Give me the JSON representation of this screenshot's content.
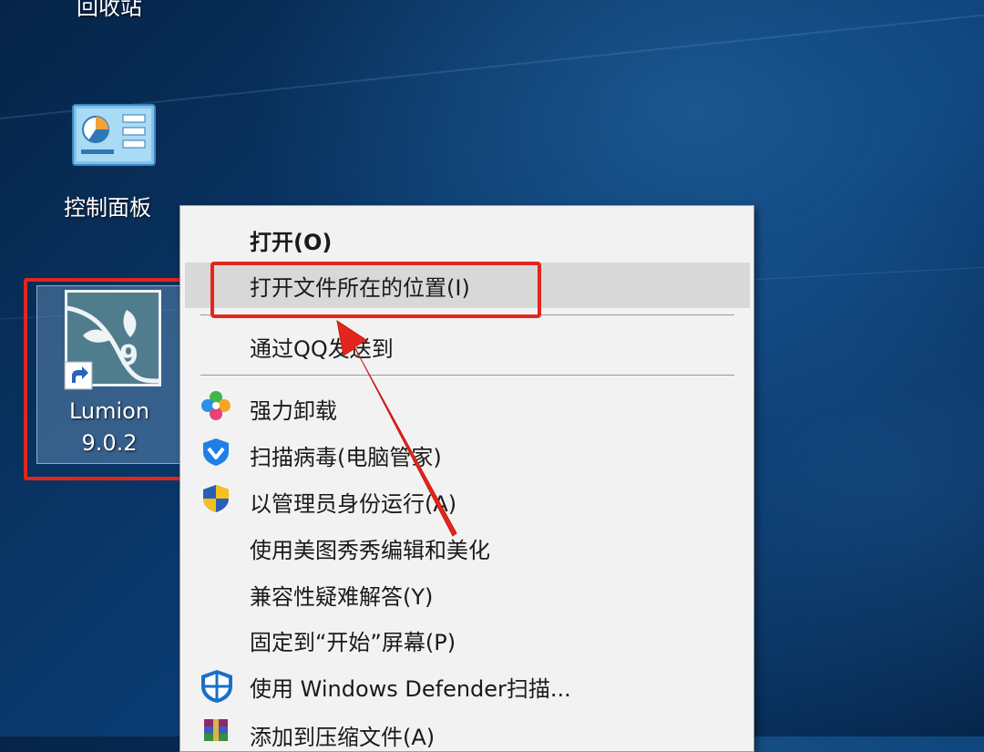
{
  "desktop": {
    "recycle_bin_label": "回收站",
    "control_panel_label": "控制面板",
    "lumion": {
      "name_line1": "Lumion",
      "name_line2": "9.0.2",
      "badge": "9"
    }
  },
  "context_menu": {
    "items": [
      {
        "label": "打开(O)",
        "icon": "none",
        "bold": true
      },
      {
        "label": "打开文件所在的位置(I)",
        "icon": "none",
        "highlighted": true
      },
      {
        "label": "通过QQ发送到",
        "icon": "none"
      },
      {
        "label": "强力卸载",
        "icon": "colorful-flower-icon"
      },
      {
        "label": "扫描病毒(电脑管家)",
        "icon": "tencent-shield-icon"
      },
      {
        "label": "以管理员身份运行(A)",
        "icon": "uac-shield-icon"
      },
      {
        "label": "使用美图秀秀编辑和美化",
        "icon": "none"
      },
      {
        "label": "兼容性疑难解答(Y)",
        "icon": "none"
      },
      {
        "label": "固定到“开始”屏幕(P)",
        "icon": "none"
      },
      {
        "label": "使用 Windows Defender扫描...",
        "icon": "defender-shield-icon"
      },
      {
        "label": "添加到压缩文件(A)",
        "icon": "winrar-archive-icon"
      }
    ]
  },
  "colors": {
    "annotation_red": "#e2261d",
    "menu_background": "#f2f2f2",
    "menu_highlight": "#d8d8d8",
    "desktop_blue": "#0a3a6e"
  }
}
